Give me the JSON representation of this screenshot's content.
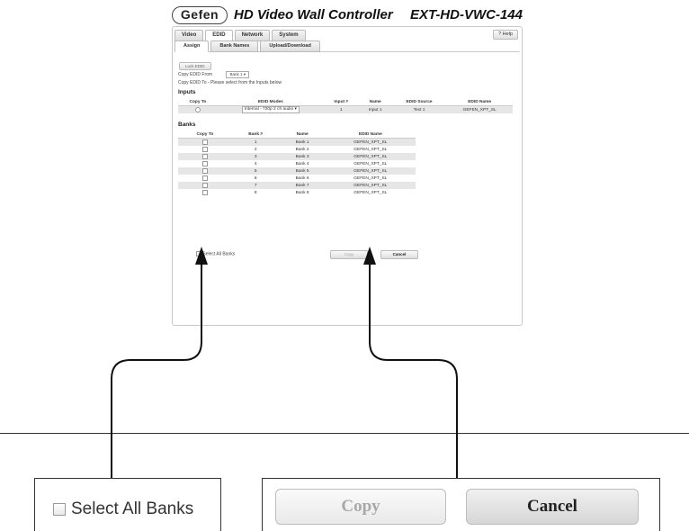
{
  "header": {
    "logo": "Gefen",
    "title": "HD Video Wall Controller",
    "model": "EXT-HD-VWC-144"
  },
  "tabs": [
    "Video",
    "EDID",
    "Network",
    "System"
  ],
  "help_label": "? Help",
  "subtabs": [
    "Assign",
    "Bank Names",
    "Upload/Download"
  ],
  "lock_edid_label": "Lock EDID",
  "copy_from_label": "Copy EDID From",
  "copy_from_value": "Bank 1",
  "copy_to_label": "Copy EDID To - Please select from the Inputs below",
  "inputs": {
    "title": "Inputs",
    "headers": [
      "Copy To",
      "EDID Modes",
      "Input #",
      "Name",
      "EDID Source",
      "EDID Name"
    ],
    "row": {
      "mode": "Internal - 720p 2 ch audio",
      "input_no": "1",
      "name": "Input 1",
      "source": "Text 1",
      "edid_name": "GEFEN_XPT_SL"
    }
  },
  "banks": {
    "title": "Banks",
    "headers": [
      "Copy To",
      "Bank #",
      "Name",
      "EDID Name"
    ],
    "rows": [
      {
        "no": "1",
        "name": "Bank 1",
        "edid": "GEFEN_XPT_SL"
      },
      {
        "no": "2",
        "name": "Bank 2",
        "edid": "GEFEN_XPT_SL"
      },
      {
        "no": "3",
        "name": "Bank 3",
        "edid": "GEFEN_XPT_SL"
      },
      {
        "no": "4",
        "name": "Bank 4",
        "edid": "GEFEN_XPT_SL"
      },
      {
        "no": "5",
        "name": "Bank 5",
        "edid": "GEFEN_XPT_SL"
      },
      {
        "no": "6",
        "name": "Bank 6",
        "edid": "GEFEN_XPT_SL"
      },
      {
        "no": "7",
        "name": "Bank 7",
        "edid": "GEFEN_XPT_SL"
      },
      {
        "no": "8",
        "name": "Bank 8",
        "edid": "GEFEN_XPT_SL"
      }
    ]
  },
  "select_all_label": "Select All Banks",
  "copy_label": "Copy",
  "cancel_label": "Cancel",
  "zoom": {
    "select_all_label": "Select All Banks",
    "copy_label": "Copy",
    "cancel_label": "Cancel"
  }
}
